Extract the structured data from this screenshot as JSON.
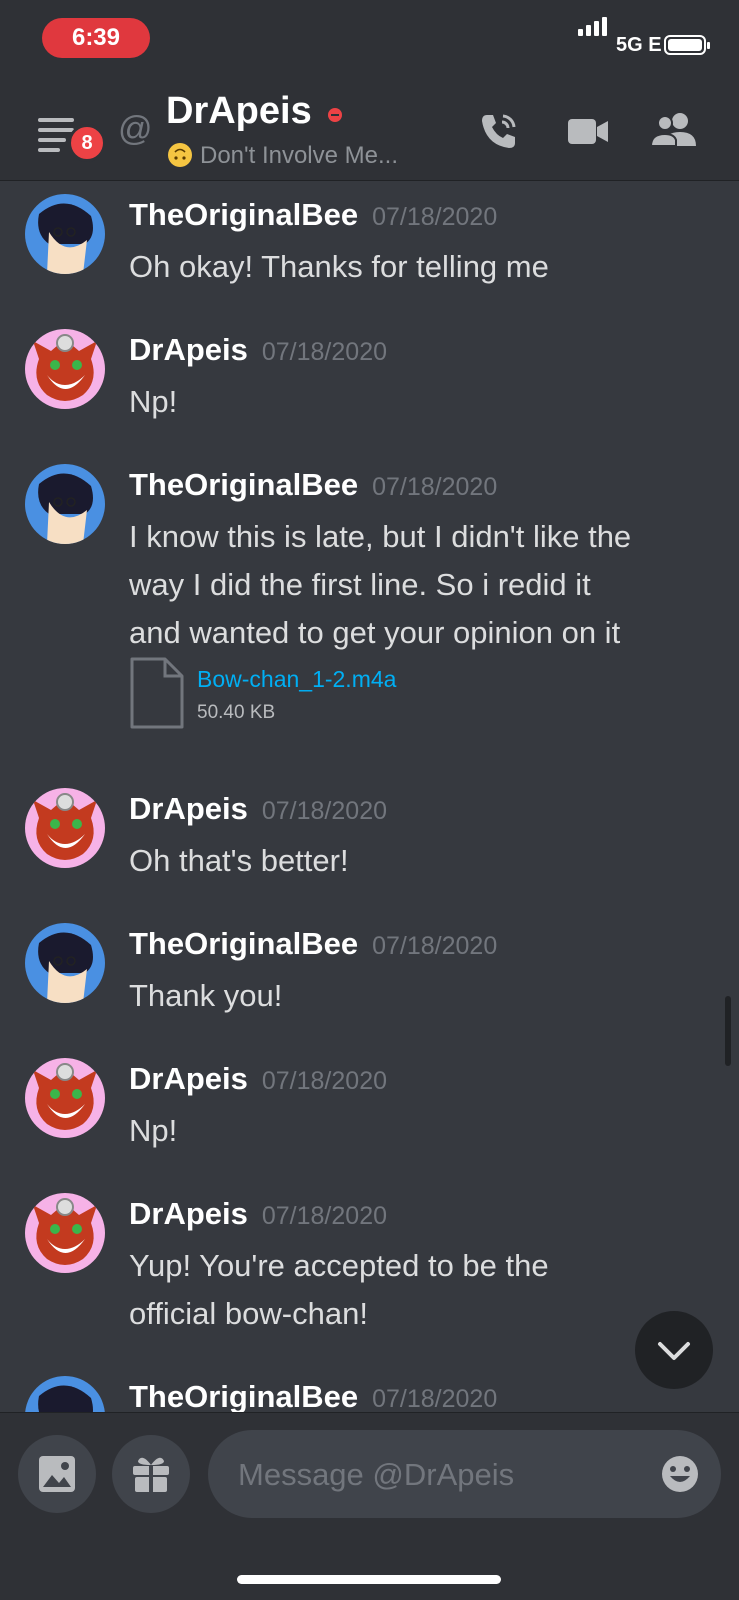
{
  "status_bar": {
    "time": "6:39",
    "network": "5G E"
  },
  "header": {
    "unread_count": "8",
    "at_symbol": "@",
    "dm_name": "DrApeis",
    "custom_status": "Don't Involve Me..."
  },
  "messages": [
    {
      "author": "TheOriginalBee",
      "timestamp": "07/18/2020",
      "lines": [
        "Oh okay! Thanks for telling me"
      ]
    },
    {
      "author": "DrApeis",
      "timestamp": "07/18/2020",
      "lines": [
        "Np!"
      ]
    },
    {
      "author": "TheOriginalBee",
      "timestamp": "07/18/2020",
      "lines": [
        "I know this is late, but I didn't like the",
        "way I did the first line. So i redid it",
        "and wanted to get your opinion on it"
      ],
      "attachment": {
        "name": "Bow-chan_1-2.m4a",
        "size": "50.40 KB"
      }
    },
    {
      "author": "DrApeis",
      "timestamp": "07/18/2020",
      "lines": [
        "Oh that's better!"
      ]
    },
    {
      "author": "TheOriginalBee",
      "timestamp": "07/18/2020",
      "lines": [
        "Thank you!"
      ]
    },
    {
      "author": "DrApeis",
      "timestamp": "07/18/2020",
      "lines": [
        "Np!"
      ]
    },
    {
      "author": "DrApeis",
      "timestamp": "07/18/2020",
      "lines": [
        "Yup! You're accepted to be the",
        "official bow-chan!"
      ]
    },
    {
      "author": "TheOriginalBee",
      "timestamp": "07/18/2020",
      "lines": []
    }
  ],
  "composer": {
    "placeholder": "Message @DrApeis"
  },
  "colors": {
    "background": "#36393f",
    "header": "#2f3136",
    "link": "#00aff4",
    "badge": "#ed4245"
  },
  "icons": [
    "menu-icon",
    "call-icon",
    "video-icon",
    "members-icon",
    "image-icon",
    "gift-icon",
    "emoji-icon",
    "chevron-down-icon",
    "file-icon"
  ]
}
